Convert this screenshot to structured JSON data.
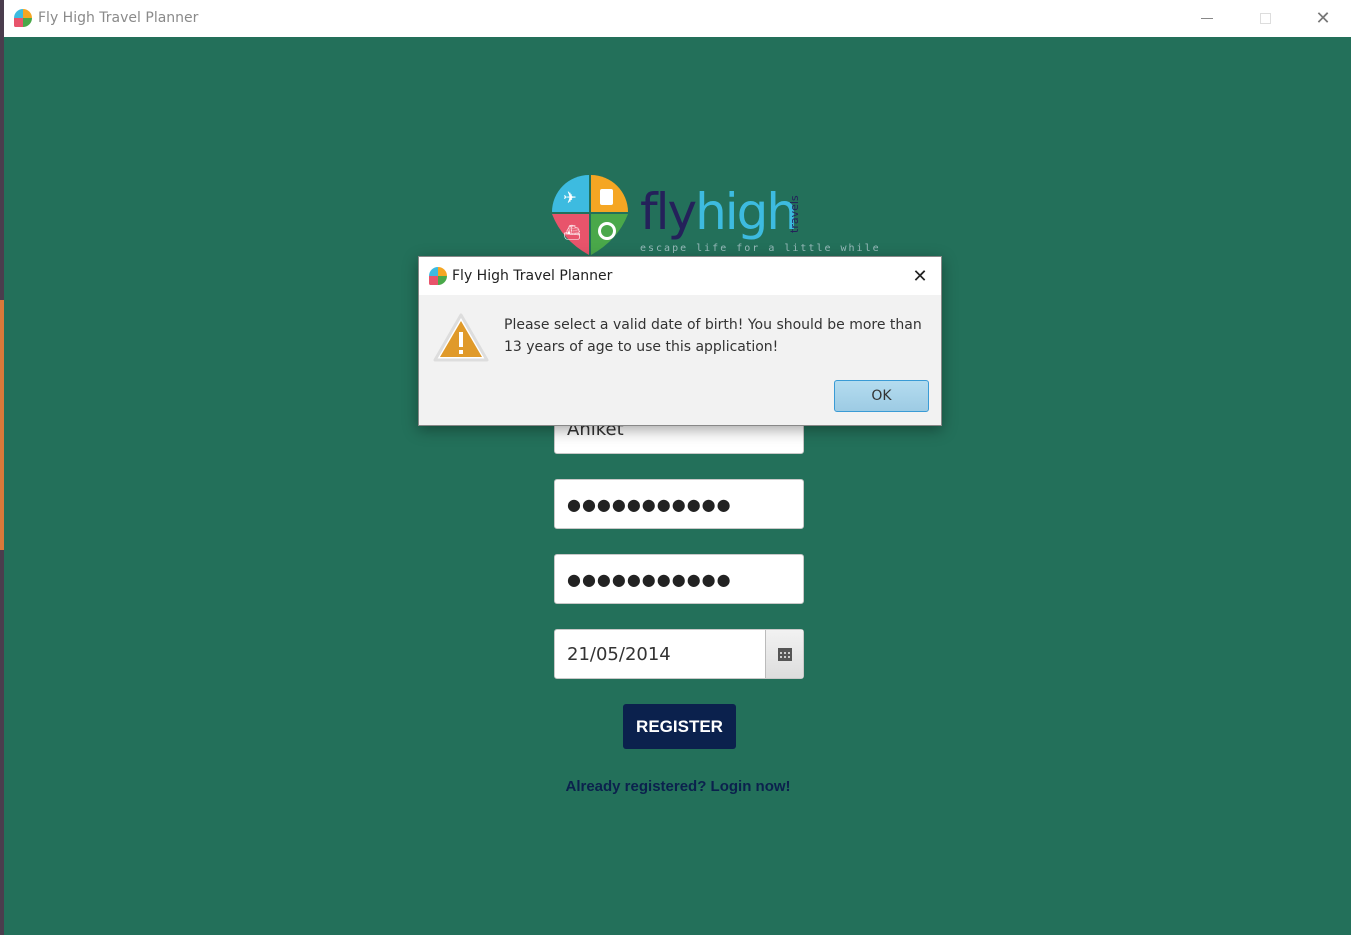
{
  "window": {
    "title": "Fly High Travel Planner",
    "controls": {
      "minimize": "minimize-icon",
      "maximize": "maximize-icon",
      "close": "close-icon"
    }
  },
  "logo": {
    "word1": "fly",
    "word2": "high",
    "side": "travels",
    "tagline": "escape life for a little while"
  },
  "form": {
    "username": "Aniket",
    "password": "●●●●●●●●●●●",
    "confirm_password": "●●●●●●●●●●●",
    "dob": "21/05/2014",
    "register_label": "REGISTER",
    "login_link": "Already registered? Login now!"
  },
  "dialog": {
    "title": "Fly High Travel Planner",
    "message": "Please select a valid date of birth! You should be more than 13 years of age to use this application!",
    "ok_label": "OK",
    "icon": "warning-icon"
  },
  "colors": {
    "background": "#23705a",
    "button": "#0b214d",
    "accent_blue": "#3dbbe0",
    "warning": "#e09a2a"
  }
}
